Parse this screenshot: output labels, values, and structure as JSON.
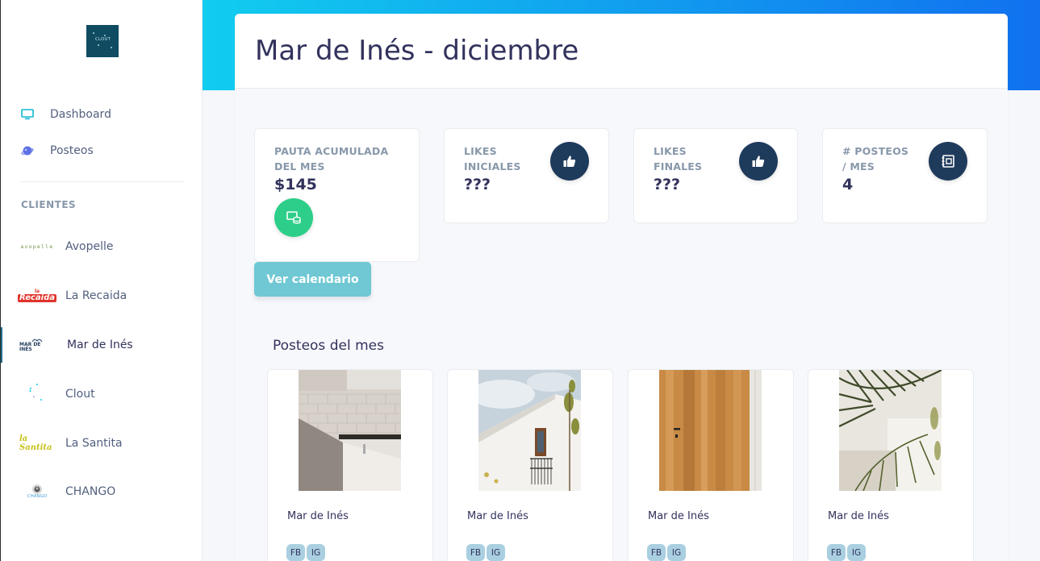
{
  "sidebar": {
    "logo_text": "CLOUT",
    "nav": [
      {
        "label": "Dashboard",
        "icon": "monitor-icon"
      },
      {
        "label": "Posteos",
        "icon": "planet-icon"
      }
    ],
    "section_heading": "CLIENTES",
    "clients": [
      {
        "label": "Avopelle",
        "active": false
      },
      {
        "label": "La Recaida",
        "active": false
      },
      {
        "label": "Mar de Inés",
        "active": true
      },
      {
        "label": "Clout",
        "active": false
      },
      {
        "label": "La Santita",
        "active": false
      },
      {
        "label": "CHANGO",
        "active": false
      }
    ],
    "client_logo_text": {
      "avopelle": "avopelle",
      "recaida_top": "la",
      "recaida_main": "Recaida",
      "mardeines": "MAR DE INÉS",
      "santita": "la Santita",
      "chango": "CHANGO"
    }
  },
  "page": {
    "title": "Mar de Inés - diciembre"
  },
  "stats": [
    {
      "title": "Pauta acumulada del mes",
      "value": "$145",
      "icon": "money-stack-icon",
      "color": "#2dce89"
    },
    {
      "title": "Likes iniciales",
      "value": "???",
      "icon": "thumbs-up-icon",
      "color": "#1f3b5c"
    },
    {
      "title": "Likes finales",
      "value": "???",
      "icon": "thumbs-up-icon",
      "color": "#1f3b5c"
    },
    {
      "title": "# Posteos / mes",
      "value": "4",
      "icon": "notebook-icon",
      "color": "#1f3b5c"
    }
  ],
  "calendar_button": "Ver calendario",
  "posts_section_title": "Posteos del mes",
  "posts": [
    {
      "name": "Mar de Inés",
      "tags": [
        "FB",
        "IG"
      ]
    },
    {
      "name": "Mar de Inés",
      "tags": [
        "FB",
        "IG"
      ]
    },
    {
      "name": "Mar de Inés",
      "tags": [
        "FB",
        "IG"
      ]
    },
    {
      "name": "Mar de Inés",
      "tags": [
        "FB",
        "IG"
      ]
    }
  ],
  "colors": {
    "header_gradient_start": "#11cdef",
    "header_gradient_end": "#1171ef",
    "success": "#2dce89",
    "dark_icon": "#1f3b5c",
    "button": "#6fc8d4",
    "tag": "#a9cfe0"
  }
}
